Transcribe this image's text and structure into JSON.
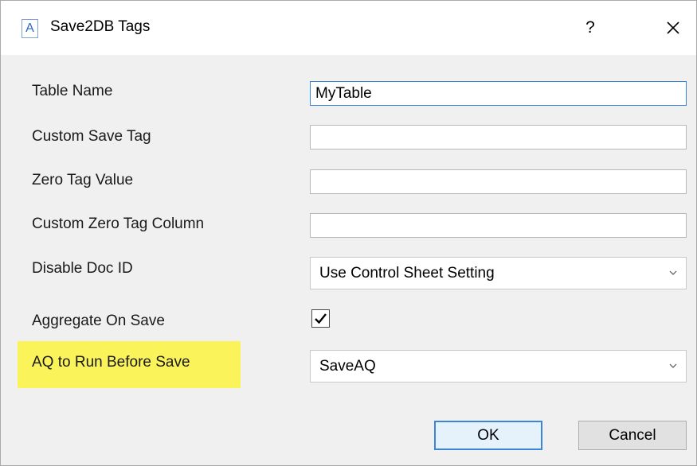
{
  "window": {
    "title": "Save2DB Tags",
    "app_icon_letter": "A",
    "help_label": "?",
    "close_label": "×"
  },
  "fields": {
    "table_name": {
      "label": "Table Name",
      "value": "MyTable"
    },
    "custom_save_tag": {
      "label": "Custom Save Tag",
      "value": ""
    },
    "zero_tag_value": {
      "label": "Zero Tag Value",
      "value": ""
    },
    "custom_zero_tag_column": {
      "label": "Custom Zero Tag Column",
      "value": ""
    },
    "disable_doc_id": {
      "label": "Disable Doc ID",
      "selected": "Use Control Sheet Setting"
    },
    "aggregate_on_save": {
      "label": "Aggregate On Save",
      "checked": true
    },
    "aq_before_save": {
      "label": "AQ to Run Before Save",
      "selected": "SaveAQ"
    }
  },
  "buttons": {
    "ok": "OK",
    "cancel": "Cancel"
  },
  "colors": {
    "highlight": "#fbf35a",
    "focus_border": "#3c85d4",
    "dialog_background": "#f0f0f0"
  }
}
